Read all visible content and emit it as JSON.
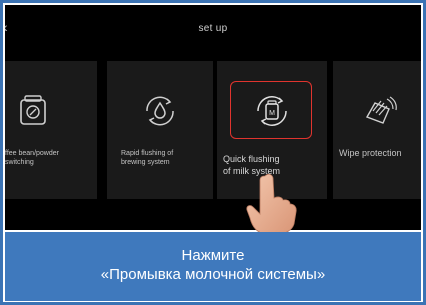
{
  "screen": {
    "title": "set up",
    "tiles": [
      {
        "label": "ffee bean/powder\n switching",
        "icon": "coffee-canister-icon"
      },
      {
        "label": "Rapid flushing of\nbrewing system",
        "icon": "drop-rinse-icon"
      },
      {
        "label": "Quick flushing\nof milk system",
        "icon": "milk-flush-icon"
      },
      {
        "label": "Wipe protection",
        "icon": "hand-wipe-icon"
      }
    ]
  },
  "caption": {
    "line1": "Нажмите",
    "line2": "«Промывка молочной системы»"
  },
  "colors": {
    "frame": "#3b73b4",
    "caption_bg": "#3f79bd",
    "highlight": "#e0342e",
    "screen_bg": "#000000",
    "tile_bg": "#1a1a1a"
  }
}
